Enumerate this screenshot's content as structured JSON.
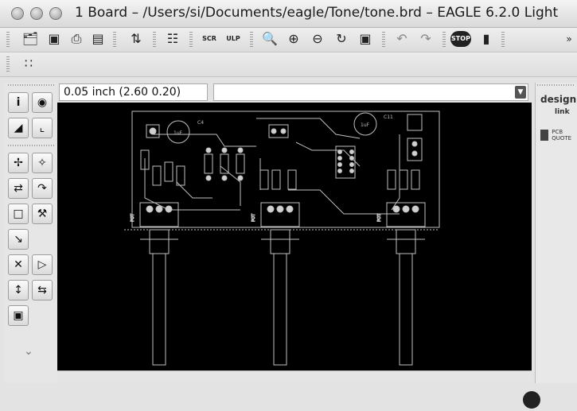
{
  "window": {
    "title": "1 Board – /Users/si/Documents/eagle/Tone/tone.brd – EAGLE 6.2.0 Light"
  },
  "toolbar": {
    "icons": [
      "open-icon",
      "save-icon",
      "print-icon",
      "cam-icon",
      "board-schematic-icon",
      "library-icon",
      "script-icon",
      "ulp-icon",
      "zoom-fit-icon",
      "zoom-in-icon",
      "zoom-out-icon",
      "zoom-redraw-icon",
      "zoom-select-icon",
      "undo-icon",
      "redo-icon",
      "stop-icon",
      "go-icon"
    ],
    "stop_label": "STOP",
    "script_label": "SCR",
    "ulp_label": "ULP"
  },
  "coordinate": {
    "display": "0.05 inch (2.60 0.20)"
  },
  "command_line": {
    "value": ""
  },
  "palette": {
    "tools": [
      "info-icon",
      "show-icon",
      "display-icon",
      "mark-icon",
      "move-icon",
      "copy-icon",
      "mirror-icon",
      "rotate-icon",
      "group-icon",
      "change-icon",
      "paste-icon",
      "delete-icon",
      "add-icon",
      "pinswap-icon",
      "replace-icon",
      "lock-icon"
    ]
  },
  "right_panel": {
    "logo_text": "design",
    "logo_sub": "link",
    "pcb_quote_line1": "PCB",
    "pcb_quote_line2": "QUOTE"
  },
  "board": {
    "labels": [
      "C4",
      "C11",
      "1uF",
      "1uF"
    ],
    "pot_labels": [
      "POT",
      "POT",
      "POT"
    ]
  },
  "colors": {
    "canvas": "#000000",
    "trace": "#bfbfbf",
    "pad": "#d0d0d0"
  }
}
